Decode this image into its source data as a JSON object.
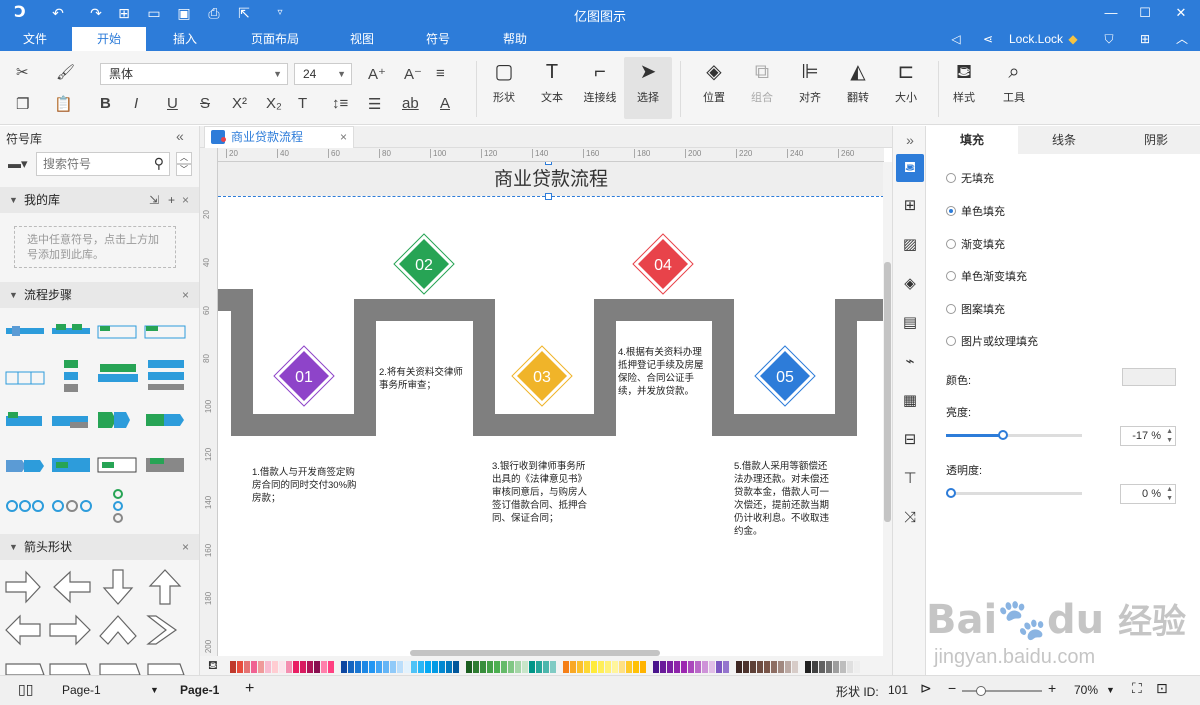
{
  "app": {
    "title": "亿图图示"
  },
  "menu": {
    "items": [
      "文件",
      "开始",
      "插入",
      "页面布局",
      "视图",
      "符号",
      "帮助"
    ],
    "active": "开始",
    "user": "Lock.Lock"
  },
  "ribbon": {
    "font_name": "黑体",
    "font_size": "24",
    "buttons": {
      "shape": "形状",
      "text": "文本",
      "connector": "连接线",
      "select": "选择",
      "position": "位置",
      "group": "组合",
      "align": "对齐",
      "flip": "翻转",
      "size": "大小",
      "style": "样式",
      "tools": "工具"
    },
    "format_glyphs": {
      "bold": "B",
      "italic": "I",
      "underline": "U",
      "strike": "S",
      "superscript": "X²",
      "subscript": "X₂",
      "font_color": "A",
      "ab": "ab"
    }
  },
  "library": {
    "title": "符号库",
    "search_placeholder": "搜索符号",
    "my_library": "我的库",
    "my_library_hint": "选中任意符号，点击上方加号添加到此库。",
    "sections": [
      "流程步骤",
      "箭头形状"
    ]
  },
  "document": {
    "tab": "商业贷款流程",
    "title": "商业贷款流程",
    "ruler_marks": [
      "20",
      "40",
      "60",
      "80",
      "100",
      "120",
      "140",
      "160",
      "180",
      "200",
      "220",
      "240",
      "260"
    ],
    "ruler_v_marks": [
      "20",
      "40",
      "60",
      "80",
      "100",
      "120",
      "140",
      "160",
      "180",
      "200"
    ],
    "steps": [
      {
        "num": "01",
        "color": "#8e44c9",
        "text": "1.借款人与开发商签定购房合同的同时交付30%购房款；"
      },
      {
        "num": "02",
        "color": "#27a455",
        "text": "2.将有关资料交律师事务所审查；"
      },
      {
        "num": "03",
        "color": "#f0b429",
        "text": "3.银行收到律师事务所出具的《法律意见书》审核同意后，与购房人签订借款合同、抵押合同、保证合同；"
      },
      {
        "num": "04",
        "color": "#e8434a",
        "text": "4.根据有关资料办理抵押登记手续及房屋保险、合同公证手续，并发放贷款。"
      },
      {
        "num": "05",
        "color": "#2d7cd9",
        "text": "5.借款人采用等额偿还法办理还款。对未偿还贷款本金，借款人可一次偿还，提前还款当期仍计收利息。不收取违约金。"
      }
    ]
  },
  "properties": {
    "tabs": [
      "填充",
      "线条",
      "阴影"
    ],
    "active_tab": "填充",
    "fill_options": [
      "无填充",
      "单色填充",
      "渐变填充",
      "单色渐变填充",
      "图案填充",
      "图片或纹理填充"
    ],
    "selected_fill": "单色填充",
    "color_label": "颜色:",
    "brightness_label": "亮度:",
    "brightness_value": "-17 %",
    "brightness_fraction": 0.42,
    "transparency_label": "透明度:",
    "transparency_value": "0 %",
    "transparency_fraction": 0.0
  },
  "status": {
    "page_dropdown": "Page-1",
    "page_tab": "Page-1",
    "shape_id_label": "形状 ID:",
    "shape_id": "101",
    "zoom": "70%"
  },
  "watermark": {
    "brand": "Bai",
    "brand2": "du",
    "site": "jingyan.baidu.com",
    "jingyan": "经验"
  }
}
